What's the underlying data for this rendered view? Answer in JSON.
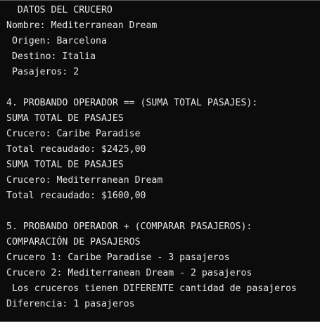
{
  "console": {
    "lines": [
      "  DATOS DEL CRUCERO",
      "Nombre: Mediterranean Dream",
      " Origen: Barcelona",
      " Destino: Italia",
      " Pasajeros: 2",
      "",
      "4. PROBANDO OPERADOR == (SUMA TOTAL PASAJES):",
      "SUMA TOTAL DE PASAJES",
      "Crucero: Caribe Paradise",
      "Total recaudado: $2425,00",
      "SUMA TOTAL DE PASAJES",
      "Crucero: Mediterranean Dream",
      "Total recaudado: $1600,00",
      "",
      "5. PROBANDO OPERADOR + (COMPARAR PASAJEROS):",
      "COMPARACIÓN DE PASAJEROS",
      "Crucero 1: Caribe Paradise - 3 pasajeros",
      "Crucero 2: Mediterranean Dream - 2 pasajeros",
      " Los cruceros tienen DIFERENTE cantidad de pasajeros",
      "Diferencia: 1 pasajeros"
    ]
  },
  "colors": {
    "background": "#0c0c0c",
    "text": "#e6e6e6",
    "border": "#5a5a5a"
  }
}
